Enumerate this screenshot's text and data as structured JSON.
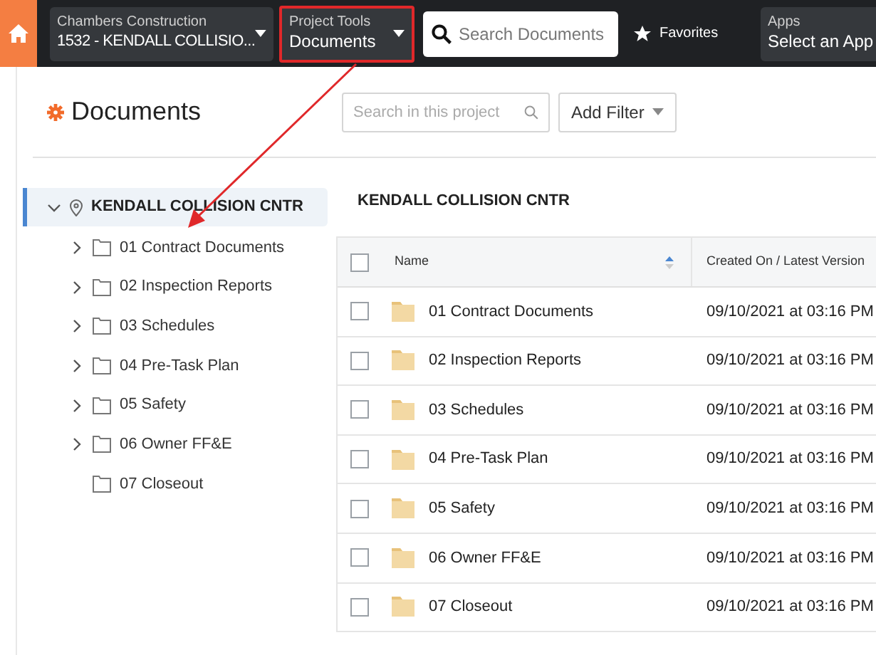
{
  "top_bar": {
    "company": {
      "label": "Chambers Construction",
      "value": "1532 - KENDALL COLLISIO..."
    },
    "project_tools": {
      "label": "Project Tools",
      "value": "Documents",
      "highlighted": true
    },
    "search": {
      "placeholder": "Search Documents"
    },
    "favorites": "Favorites",
    "apps": {
      "label": "Apps",
      "value": "Select an App"
    }
  },
  "page": {
    "title": "Documents",
    "search": {
      "placeholder": "Search in this project"
    },
    "filter_button": "Add Filter"
  },
  "tree": {
    "label": "KENDALL COLLISION CNTR",
    "expanded": true,
    "selected": true,
    "children": [
      {
        "label": "01 Contract Documents",
        "has_children": true
      },
      {
        "label": "02 Inspection Reports",
        "has_children": true
      },
      {
        "label": "03 Schedules",
        "has_children": true
      },
      {
        "label": "04 Pre-Task Plan",
        "has_children": true
      },
      {
        "label": "05 Safety",
        "has_children": true
      },
      {
        "label": "06 Owner FF&E",
        "has_children": true
      },
      {
        "label": "07 Closeout",
        "has_children": false
      }
    ]
  },
  "folder_title": "KENDALL COLLISION CNTR",
  "table": {
    "header_checked": false,
    "columns": [
      "Name",
      "Created On / Latest Version"
    ],
    "rows": [
      {
        "checked": false,
        "name": "01 Contract Documents",
        "created": "09/10/2021 at 03:16 PM"
      },
      {
        "checked": false,
        "name": "02 Inspection Reports",
        "created": "09/10/2021 at 03:16 PM"
      },
      {
        "checked": false,
        "name": "03 Schedules",
        "created": "09/10/2021 at 03:16 PM"
      },
      {
        "checked": false,
        "name": "04 Pre-Task Plan",
        "created": "09/10/2021 at 03:16 PM"
      },
      {
        "checked": false,
        "name": "05 Safety",
        "created": "09/10/2021 at 03:16 PM"
      },
      {
        "checked": false,
        "name": "06 Owner FF&E",
        "created": "09/10/2021 at 03:16 PM"
      },
      {
        "checked": false,
        "name": "07 Closeout",
        "created": "09/10/2021 at 03:16 PM"
      }
    ]
  }
}
